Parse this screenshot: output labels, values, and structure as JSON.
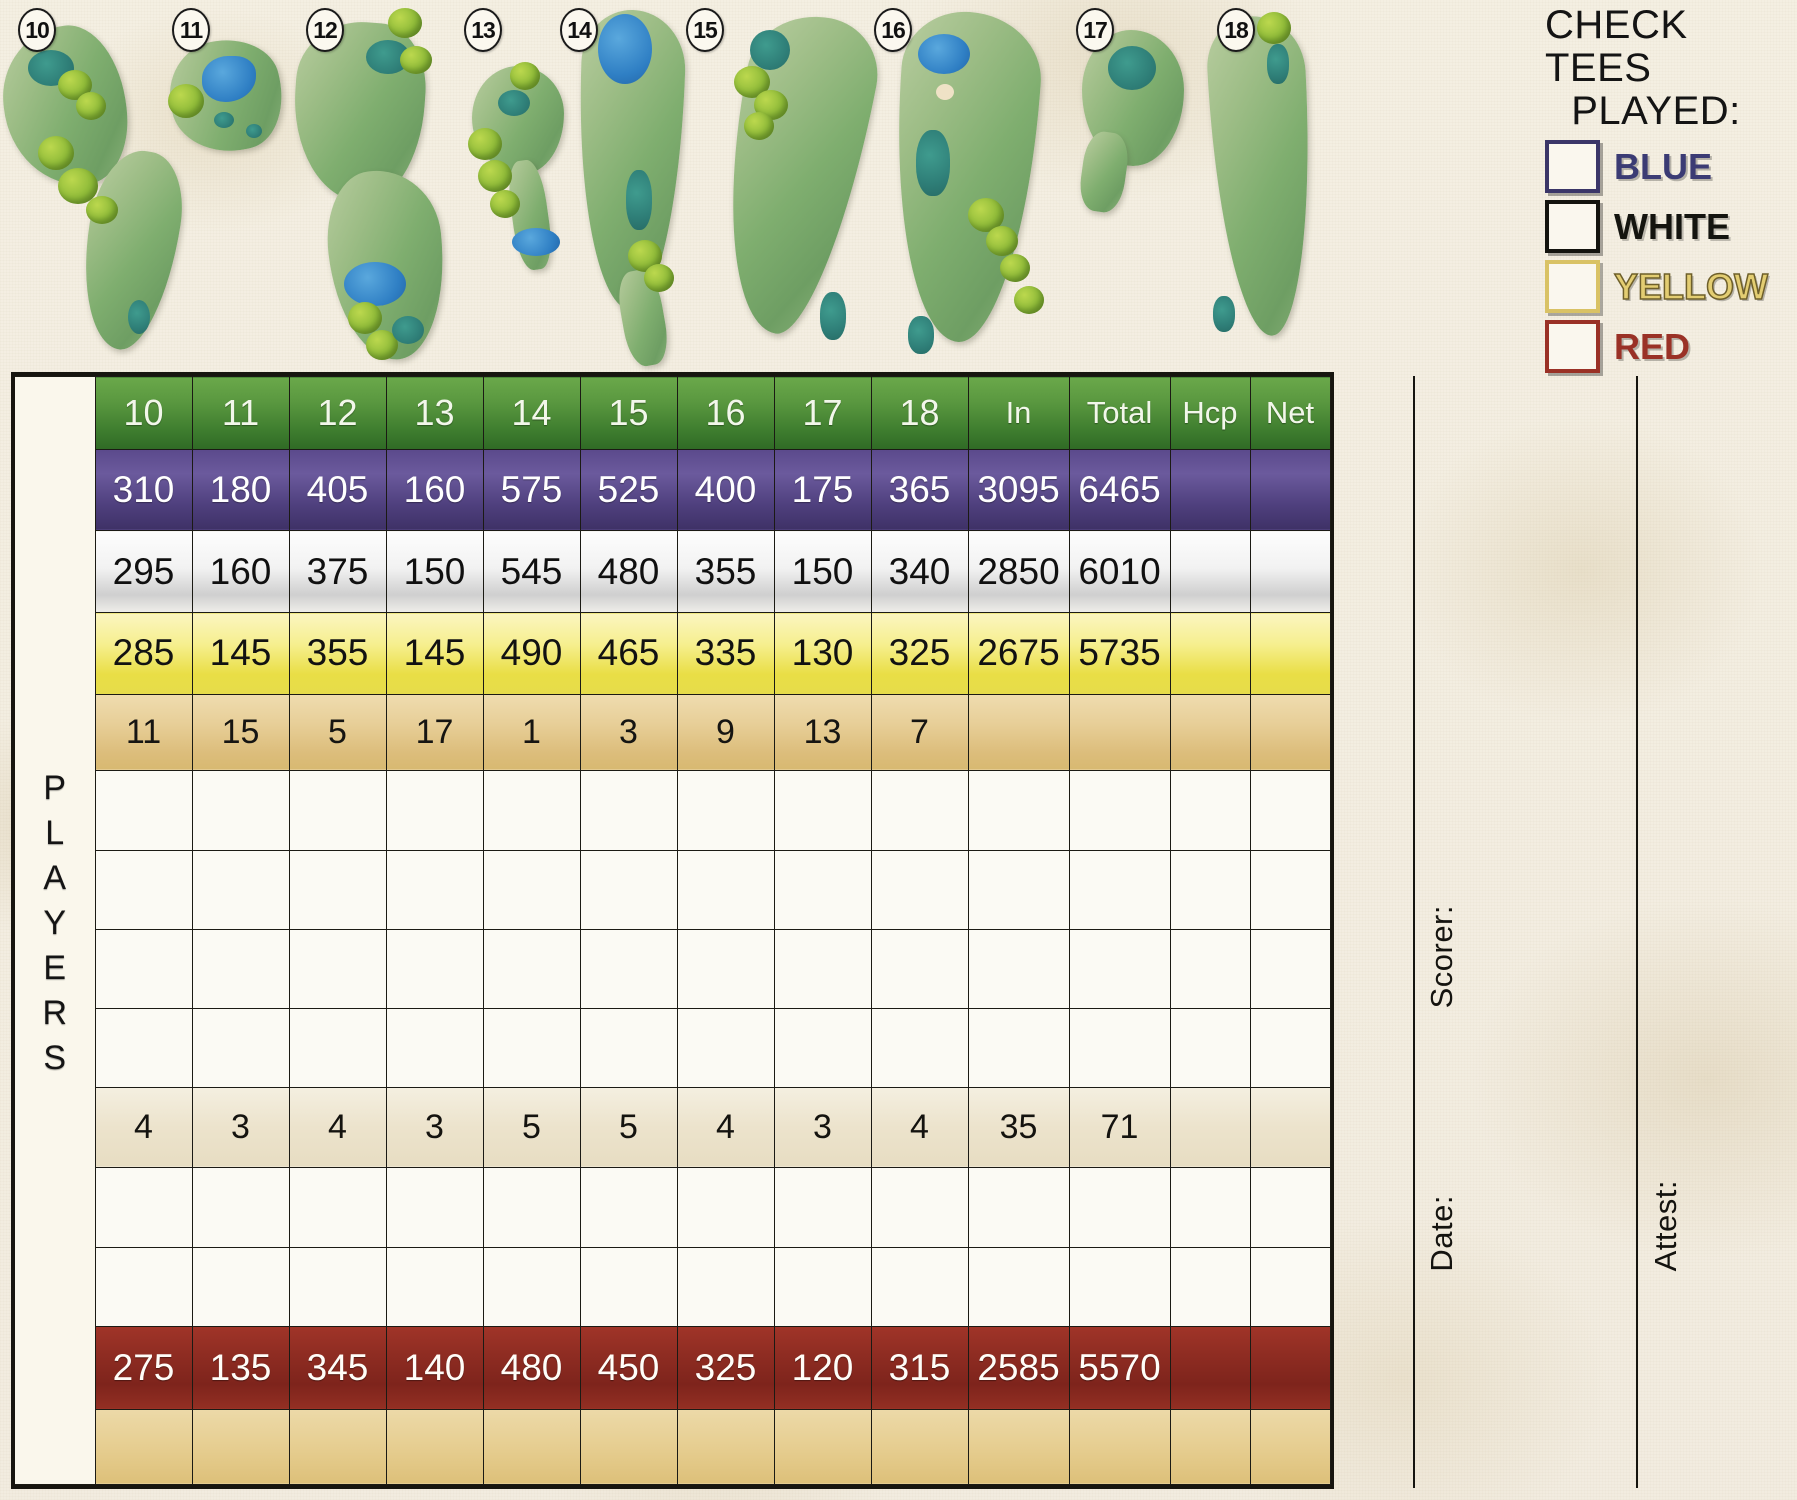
{
  "holes_strip": {
    "hole_numbers": [
      "10",
      "11",
      "12",
      "13",
      "14",
      "15",
      "16",
      "17",
      "18"
    ]
  },
  "check_tees": {
    "title_line1": "CHECK TEES",
    "title_line2": "PLAYED:",
    "options": [
      {
        "label": "BLUE",
        "box_color": "#3b3668",
        "text_color": "#3b3b74"
      },
      {
        "label": "WHITE",
        "box_color": "#14140f",
        "text_color": "#14140f"
      },
      {
        "label": "YELLOW",
        "box_color": "#d9c265",
        "text_color": "#d6bf63"
      },
      {
        "label": "RED",
        "box_color": "#9a3126",
        "text_color": "#9a3126"
      }
    ]
  },
  "scorecard": {
    "players_label": "PLAYERS",
    "columns": [
      "10",
      "11",
      "12",
      "13",
      "14",
      "15",
      "16",
      "17",
      "18",
      "In",
      "Total",
      "Hcp",
      "Net"
    ],
    "rows": {
      "blue": [
        "310",
        "180",
        "405",
        "160",
        "575",
        "525",
        "400",
        "175",
        "365",
        "3095",
        "6465",
        "",
        ""
      ],
      "white": [
        "295",
        "160",
        "375",
        "150",
        "545",
        "480",
        "355",
        "150",
        "340",
        "2850",
        "6010",
        "",
        ""
      ],
      "yellow": [
        "285",
        "145",
        "355",
        "145",
        "490",
        "465",
        "335",
        "130",
        "325",
        "2675",
        "5735",
        "",
        ""
      ],
      "handicap": [
        "11",
        "15",
        "5",
        "17",
        "1",
        "3",
        "9",
        "13",
        "7",
        "",
        "",
        "",
        ""
      ],
      "par": [
        "4",
        "3",
        "4",
        "3",
        "5",
        "5",
        "4",
        "3",
        "4",
        "35",
        "71",
        "",
        ""
      ],
      "red": [
        "275",
        "135",
        "345",
        "140",
        "480",
        "450",
        "325",
        "120",
        "315",
        "2585",
        "5570",
        "",
        ""
      ]
    },
    "blank_rows_before_par": 4,
    "blank_rows_after_par": 2
  },
  "signatures": {
    "scorer_label": "Scorer:",
    "date_label": "Date:",
    "attest_label": "Attest:"
  },
  "colors": {
    "header_green": "#3f7e2f",
    "blue_tee": "#4e3f7d",
    "white_tee": "#e9e9e9",
    "yellow_tee": "#e9de46",
    "red_tee": "#8e2c22",
    "handicap_tan": "#dcbd7b",
    "paper": "#f2ece0"
  }
}
